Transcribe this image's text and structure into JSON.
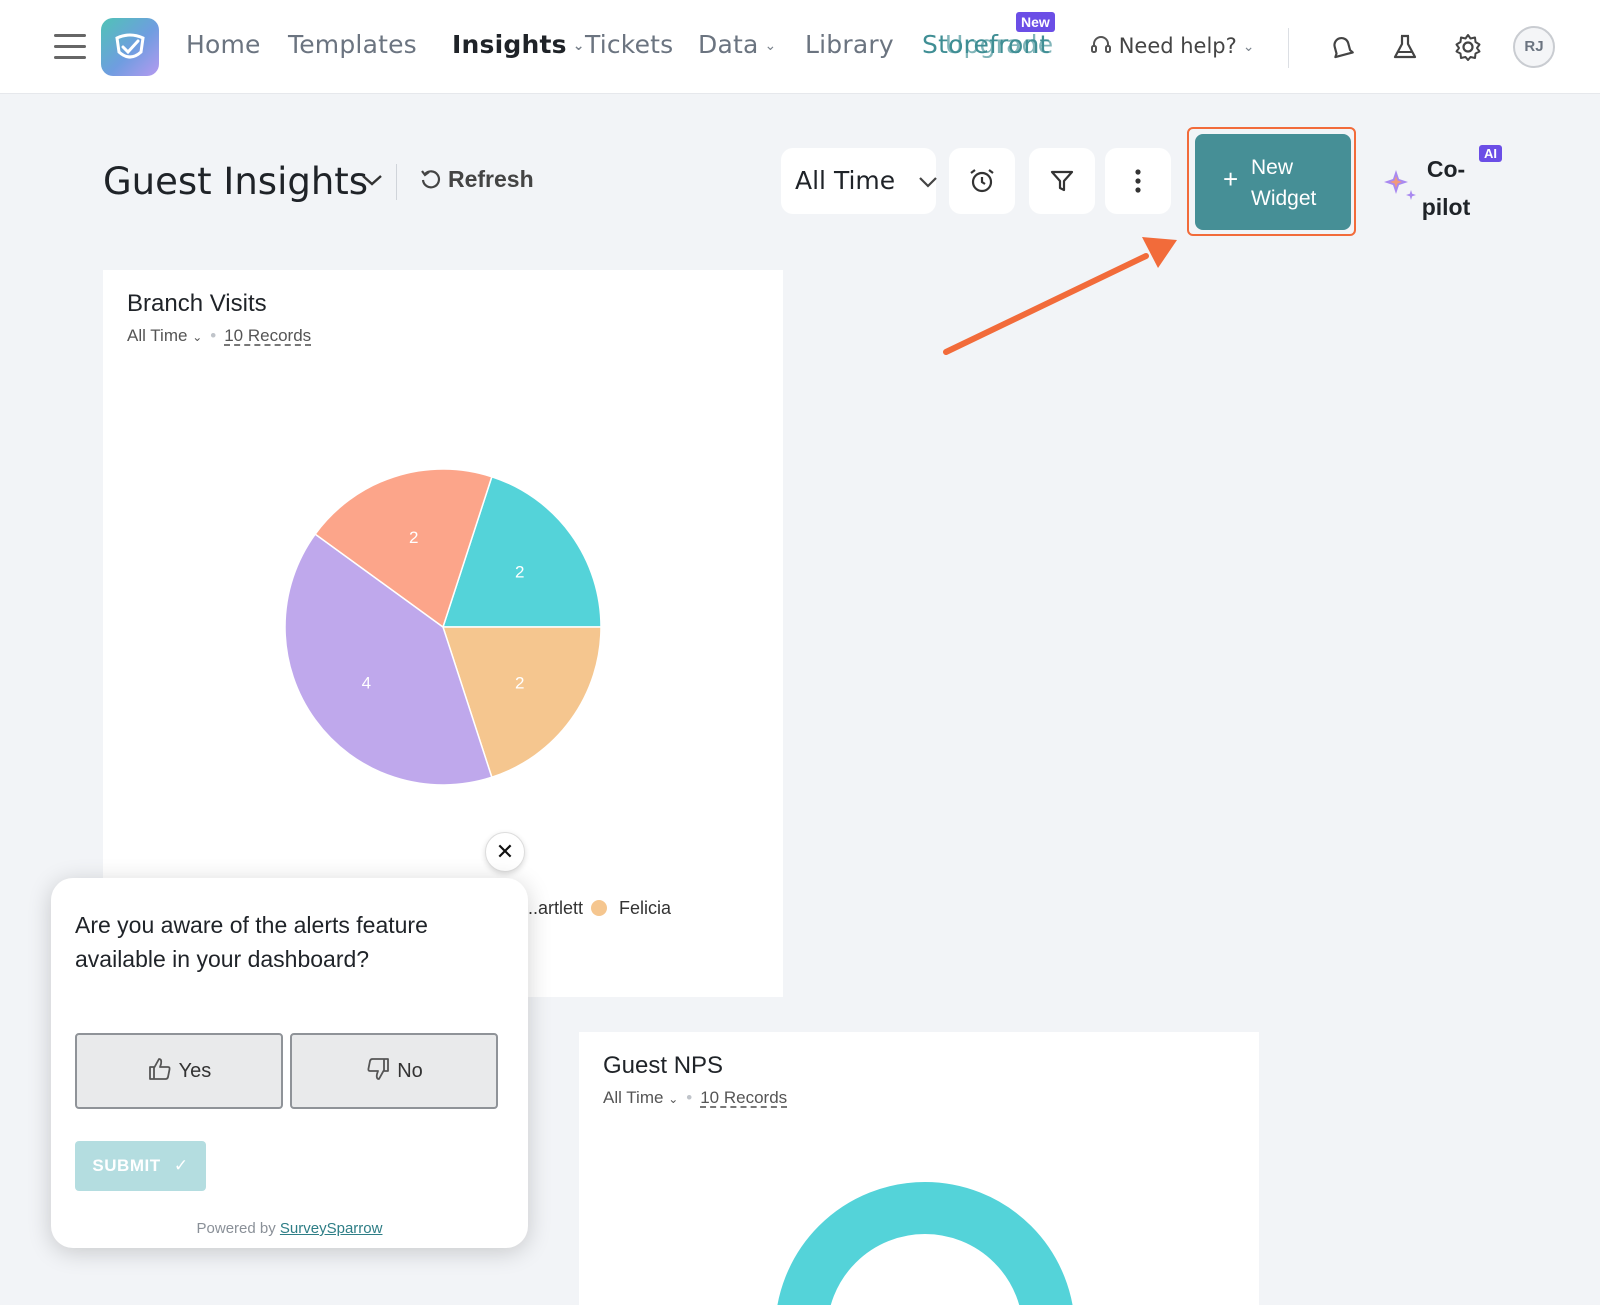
{
  "nav": {
    "items": [
      "Home",
      "Templates",
      "Insights",
      "Tickets",
      "Data",
      "Library",
      "Storefront",
      "Upgrade"
    ],
    "new_badge": "New",
    "help": "Need help?",
    "avatar": "RJ"
  },
  "header": {
    "title": "Guest Insights",
    "refresh": "Refresh",
    "time_filter": "All Time",
    "new_widget": "New Widget",
    "new_widget_l1": "New",
    "new_widget_l2": "Widget",
    "copilot_l1": "Co-",
    "copilot_l2": "pilot",
    "ai_badge": "AI"
  },
  "cards": {
    "branch": {
      "title": "Branch Visits",
      "time": "All Time",
      "records": "10 Records",
      "legend": [
        "...artlett",
        "Felicia"
      ]
    },
    "nps": {
      "title": "Guest NPS",
      "time": "All Time",
      "records": "10 Records"
    }
  },
  "chart_data": [
    {
      "type": "pie",
      "title": "Branch Visits",
      "slices": [
        {
          "label": "",
          "value": 2,
          "color": "#54d3d9"
        },
        {
          "label": "Felicia",
          "value": 2,
          "color": "#f5c68f"
        },
        {
          "label": "",
          "value": 4,
          "color": "#bfa8ec"
        },
        {
          "label": "",
          "value": 2,
          "color": "#fca58a"
        }
      ]
    }
  ],
  "popup": {
    "question": "Are you aware of the alerts feature available in your dashboard?",
    "yes": "Yes",
    "no": "No",
    "submit": "SUBMIT",
    "powered_by": "Powered by",
    "brand": "SurveySparrow"
  },
  "colors": {
    "accent": "#468f96",
    "highlight": "#f26b3a",
    "badge": "#6b4ee6"
  }
}
